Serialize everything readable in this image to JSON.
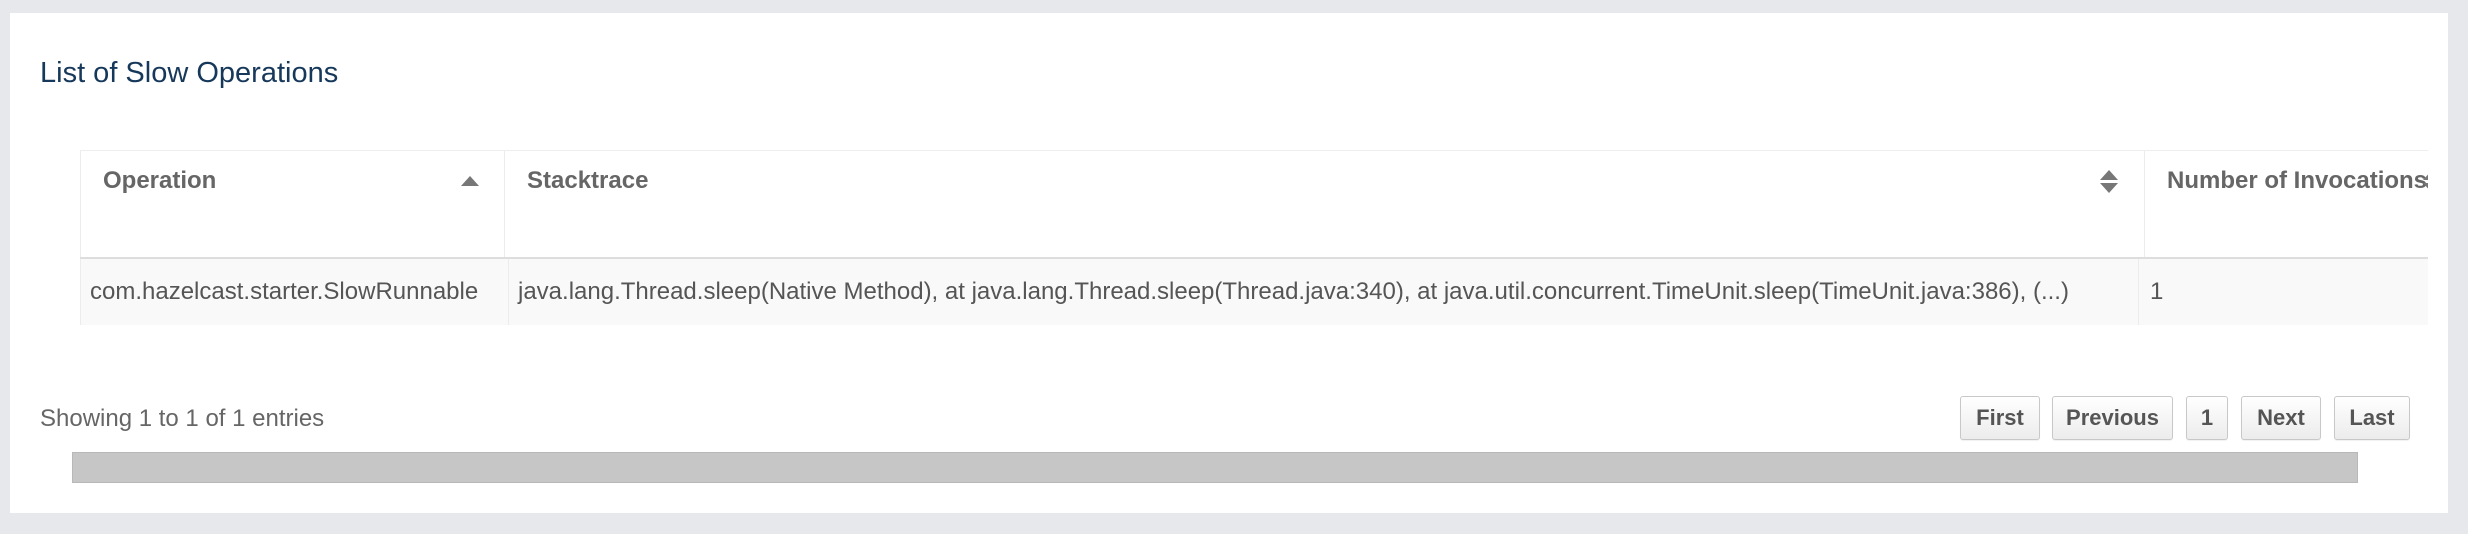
{
  "panel": {
    "title": "List of Slow Operations"
  },
  "table": {
    "columns": [
      {
        "label": "Operation",
        "sort": "asc"
      },
      {
        "label": "Stacktrace",
        "sort": "both"
      },
      {
        "label": "Number of Invocations",
        "sort": "both"
      }
    ],
    "rows": [
      {
        "operation": "com.hazelcast.starter.SlowRunnable",
        "stacktrace": "java.lang.Thread.sleep(Native Method), at java.lang.Thread.sleep(Thread.java:340), at java.util.concurrent.TimeUnit.sleep(TimeUnit.java:386), (...)",
        "invocations": "1"
      }
    ]
  },
  "footer": {
    "info": "Showing 1 to 1 of 1 entries"
  },
  "pagination": {
    "first": "First",
    "previous": "Previous",
    "page": "1",
    "next": "Next",
    "last": "Last"
  },
  "colors": {
    "title": "#16385a",
    "background": "#e6e8ec",
    "panel": "#ffffff",
    "row_stripe": "#f9f9f9",
    "scrollbar": "#c6c6c6"
  },
  "icons": {
    "operation_sort": "sort-ascending-icon",
    "stacktrace_sort": "sort-both-icon",
    "invocations_sort": "sort-both-icon"
  }
}
